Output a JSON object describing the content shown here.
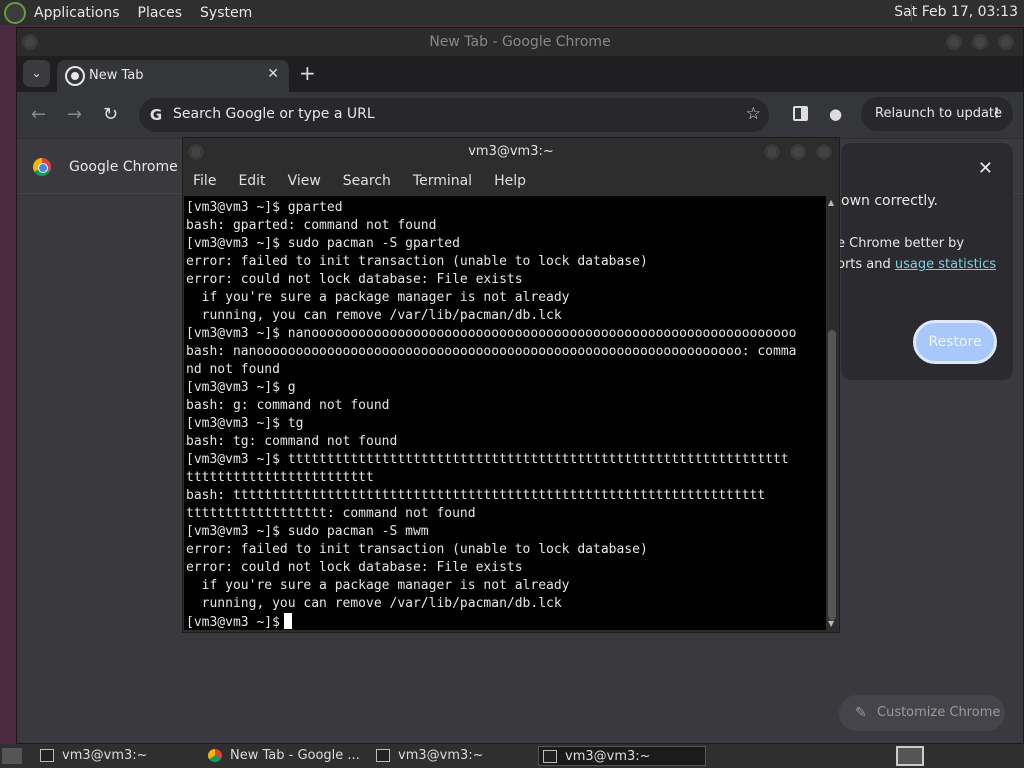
{
  "top_panel": {
    "menus": [
      "Applications",
      "Places",
      "System"
    ],
    "clock": "Sat Feb 17, 03:13"
  },
  "chrome": {
    "window_title": "New Tab - Google Chrome",
    "tab_label": "New Tab",
    "omnibox_placeholder": "Search Google or type a URL",
    "relaunch_label": "Relaunch to update",
    "infobar_text": "Google Chrome isn",
    "restore_card": {
      "line1": "own correctly.",
      "line2": "e Chrome better by",
      "line3_prefix": "orts and ",
      "line3_link": "usage statistics",
      "button": "Restore"
    },
    "customize_label": "Customize Chrome"
  },
  "terminal": {
    "title": "vm3@vm3:~",
    "menu": [
      "File",
      "Edit",
      "View",
      "Search",
      "Terminal",
      "Help"
    ],
    "lines": [
      "[vm3@vm3 ~]$ gparted",
      "bash: gparted: command not found",
      "[vm3@vm3 ~]$ sudo pacman -S gparted",
      "error: failed to init transaction (unable to lock database)",
      "error: could not lock database: File exists",
      "  if you're sure a package manager is not already",
      "  running, you can remove /var/lib/pacman/db.lck",
      "[vm3@vm3 ~]$ nanoooooooooooooooooooooooooooooooooooooooooooooooooooooooooooooo",
      "bash: nanoooooooooooooooooooooooooooooooooooooooooooooooooooooooooooooo: comma",
      "nd not found",
      "[vm3@vm3 ~]$ g",
      "bash: g: command not found",
      "[vm3@vm3 ~]$ tg",
      "bash: tg: command not found",
      "[vm3@vm3 ~]$ tttttttttttttttttttttttttttttttttttttttttttttttttttttttttttttttt",
      "tttttttttttttttttttttttt",
      "bash: tttttttttttttttttttttttttttttttttttttttttttttttttttttttttttttttttttt",
      "tttttttttttttttttt: command not found",
      "[vm3@vm3 ~]$ sudo pacman -S mwm",
      "error: failed to init transaction (unable to lock database)",
      "error: could not lock database: File exists",
      "  if you're sure a package manager is not already",
      "  running, you can remove /var/lib/pacman/db.lck"
    ],
    "prompt": "[vm3@vm3 ~]$"
  },
  "taskbar": {
    "tasks": [
      "vm3@vm3:~",
      "New Tab - Google ...",
      "vm3@vm3:~",
      "vm3@vm3:~"
    ]
  }
}
